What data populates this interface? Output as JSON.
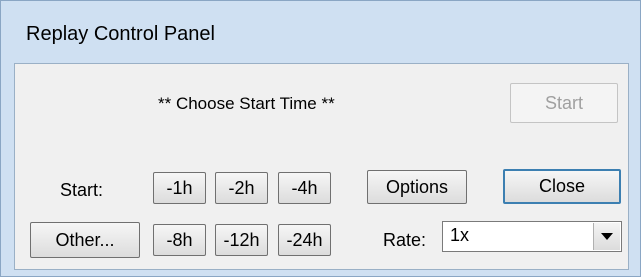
{
  "window": {
    "title": "Replay Control Panel"
  },
  "status_text": "** Choose Start Time **",
  "start_button": "Start",
  "start_label": "Start:",
  "other_button": "Other...",
  "offsets_row1": [
    "-1h",
    "-2h",
    "-4h"
  ],
  "offsets_row2": [
    "-8h",
    "-12h",
    "-24h"
  ],
  "options_button": "Options",
  "close_button": "Close",
  "rate": {
    "label": "Rate:",
    "value": "1x"
  },
  "icons": {
    "rate_dropdown": "triangle-down-icon"
  }
}
